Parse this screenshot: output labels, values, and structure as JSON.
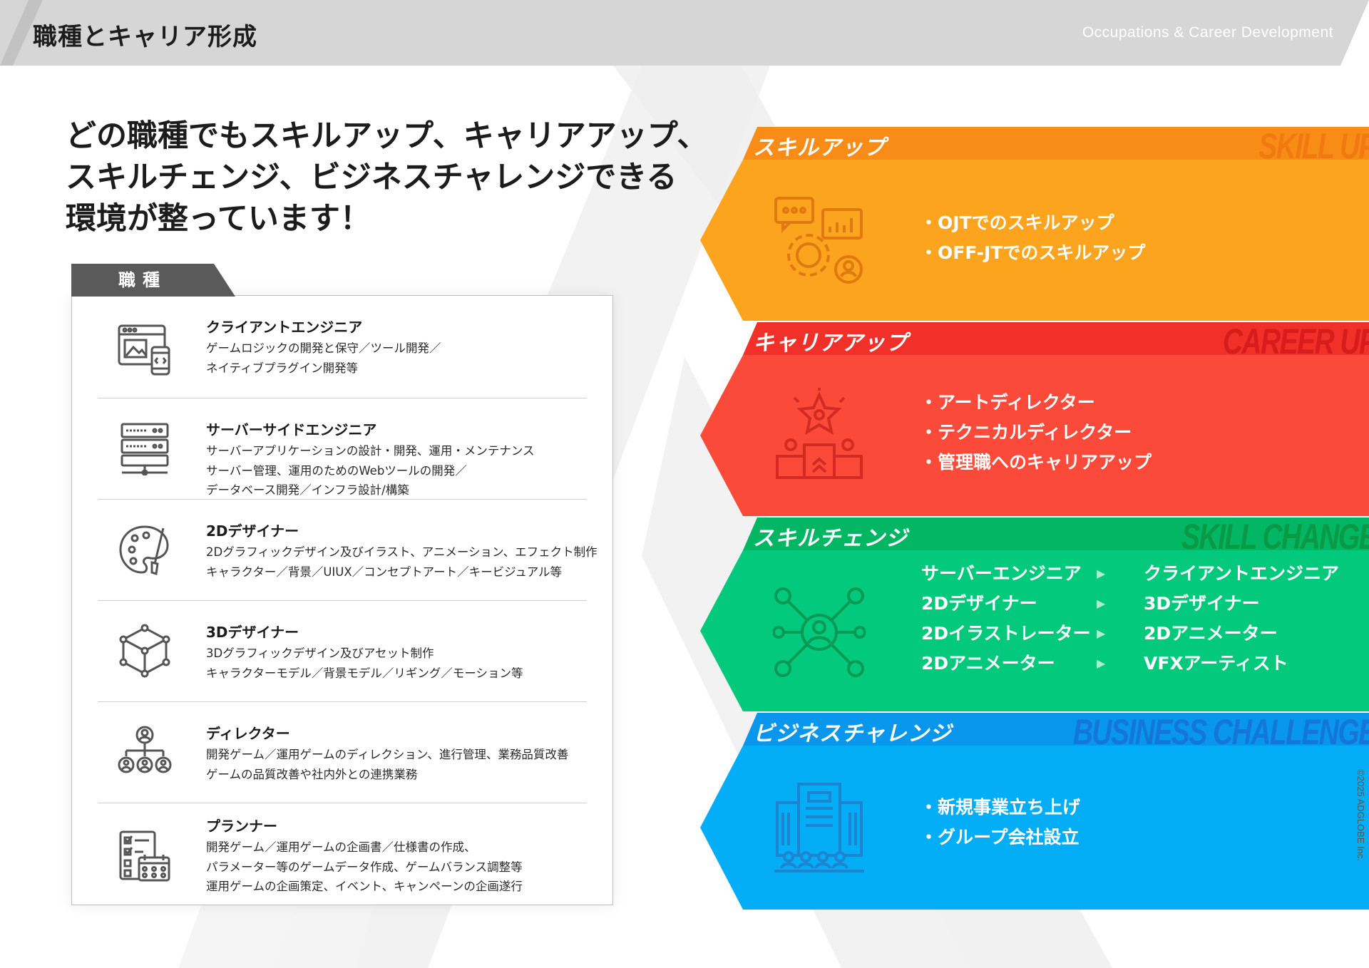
{
  "header": {
    "title": "職種とキャリア形成",
    "subtitle": "Occupations & Career Development"
  },
  "headline": {
    "lines": [
      "どの職種でもスキルアップ、キャリアアップ、",
      "スキルチェンジ、ビジネスチャレンジできる",
      "環境が整っています！"
    ]
  },
  "occupations": {
    "tab_label": "職種",
    "items": [
      {
        "title": "クライアントエンジニア",
        "lines": [
          "ゲームロジックの開発と保守／ツール開発／",
          "ネイティブプラグイン開発等"
        ],
        "icon": "browser-mobile-code-icon"
      },
      {
        "title": "サーバーサイドエンジニア",
        "lines": [
          "サーバーアプリケーションの設計・開発、運用・メンテナンス",
          "サーバー管理、運用のためのWebツールの開発／",
          "データベース開発／インフラ設計/構築"
        ],
        "icon": "server-rack-icon"
      },
      {
        "title": "2Dデザイナー",
        "lines": [
          "2Dグラフィックデザイン及びイラスト、アニメーション、エフェクト制作",
          "キャラクター／背景／UIUX／コンセプトアート／キービジュアル等"
        ],
        "icon": "palette-brush-icon"
      },
      {
        "title": "3Dデザイナー",
        "lines": [
          "3Dグラフィックデザイン及びアセット制作",
          "キャラクターモデル／背景モデル／リギング／モーション等"
        ],
        "icon": "cube-wireframe-icon"
      },
      {
        "title": "ディレクター",
        "lines": [
          "開発ゲーム／運用ゲームのディレクション、進行管理、業務品質改善",
          "ゲームの品質改善や社内外との連携業務"
        ],
        "icon": "team-hierarchy-icon"
      },
      {
        "title": "プランナー",
        "lines": [
          "開発ゲーム／運用ゲームの企画書／仕様書の作成、",
          "パラメーター等のゲームデータ作成、ゲームバランス調整等",
          "運用ゲームの企画策定、イベント、キャンペーンの企画遂行"
        ],
        "icon": "checklist-calendar-icon"
      }
    ]
  },
  "banners": {
    "skill_up": {
      "label": "スキルアップ",
      "en": "SKILL UP",
      "icon": "gear-chat-chart-icon",
      "color": "#fca41e",
      "strip_color": "#f98c17",
      "en_color": "#f07a10",
      "items": [
        "・OJTでのスキルアップ",
        "・OFF-JTでのスキルアップ"
      ]
    },
    "career_up": {
      "label": "キャリアアップ",
      "en": "CAREER UP",
      "icon": "star-podium-icon",
      "color": "#fc4a3a",
      "strip_color": "#f2302a",
      "en_color": "#d81b1b",
      "items": [
        "・アートディレクター",
        "・テクニカルディレクター",
        "・管理職へのキャリアアップ"
      ]
    },
    "skill_change": {
      "label": "スキルチェンジ",
      "en": "SKILL CHANGE",
      "icon": "person-network-icon",
      "color": "#03c97c",
      "strip_color": "#02b664",
      "en_color": "#0a9a45",
      "rows": [
        {
          "from": "サーバーエンジニア",
          "to": "クライアントエンジニア"
        },
        {
          "from": "2Dデザイナー",
          "to": "3Dデザイナー"
        },
        {
          "from": "2Dイラストレーター",
          "to": "2Dアニメーター"
        },
        {
          "from": "2Dアニメーター",
          "to": "VFXアーティスト"
        }
      ],
      "arrow": "▶"
    },
    "business_challenge": {
      "label": "ビジネスチャレンジ",
      "en": "BUSINESS CHALLENGE",
      "icon": "corporate-building-icon",
      "color": "#04aef7",
      "strip_color": "#0897ec",
      "en_color": "#1477d8",
      "items": [
        "・新規事業立ち上げ",
        "・グループ会社設立"
      ]
    }
  },
  "copyright": "©2025 ADGLOBE Inc."
}
